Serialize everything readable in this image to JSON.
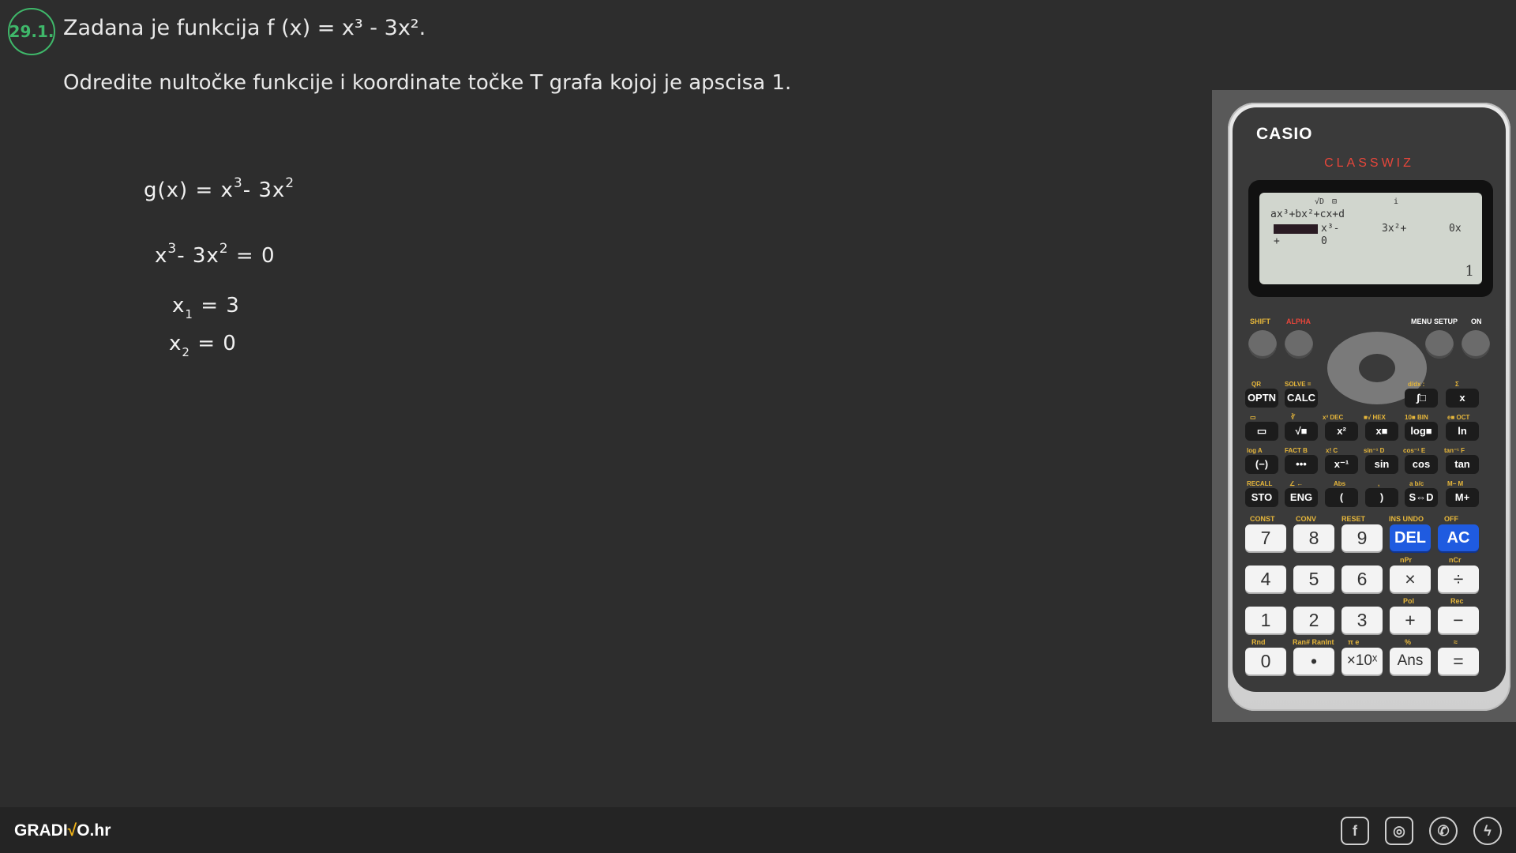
{
  "problem": {
    "number": "29.1.",
    "line1": "Zadana je funkcija f (x) = x³ - 3x².",
    "line2": "Odredite nultočke funkcije i koordinate točke T grafa kojoj je apscisa 1."
  },
  "work": {
    "line1_lhs": "g(x) = x",
    "line1_exp1": "3",
    "line1_mid": "- 3x",
    "line1_exp2": "2",
    "line2_a": "x",
    "line2_exp1": "3",
    "line2_b": "- 3x",
    "line2_exp2": "2",
    "line2_c": "= 0",
    "root1_var": "x",
    "root1_sub": "1",
    "root1_val": "= 3",
    "root2_var": "x",
    "root2_sub": "2",
    "root2_val": "= 0"
  },
  "calculator": {
    "brand": "CASIO",
    "model": "CLASSWIZ",
    "lcd": {
      "indicators": [
        "√D",
        "⊟",
        "i"
      ],
      "form": "ax³+bx²+cx+d",
      "term1": "x³-",
      "term2": "3x²+",
      "term3": "0x",
      "row3_a": "+",
      "row3_b": "0",
      "result": "1"
    },
    "top_labels": {
      "shift": "SHIFT",
      "alpha": "ALPHA",
      "menu_setup": "MENU SETUP",
      "on": "ON"
    },
    "func_rows": [
      [
        {
          "label": "OPTN",
          "note": "QR"
        },
        {
          "label": "CALC",
          "note": "SOLVE ="
        },
        {
          "label": "∫□",
          "note": "d/dx  :"
        },
        {
          "label": "x",
          "note": "Σ"
        }
      ],
      [
        {
          "label": "▭",
          "note": "▭"
        },
        {
          "label": "√■",
          "note": "∛"
        },
        {
          "label": "x²",
          "note": "x³ DEC"
        },
        {
          "label": "x■",
          "note": "■√ HEX"
        },
        {
          "label": "log■",
          "note": "10■ BIN"
        },
        {
          "label": "ln",
          "note": "e■ OCT"
        }
      ],
      [
        {
          "label": "(−)",
          "note": "log A"
        },
        {
          "label": "•••",
          "note": "FACT B"
        },
        {
          "label": "x⁻¹",
          "note": "x! C"
        },
        {
          "label": "sin",
          "note": "sin⁻¹ D"
        },
        {
          "label": "cos",
          "note": "cos⁻¹ E"
        },
        {
          "label": "tan",
          "note": "tan⁻¹ F"
        }
      ],
      [
        {
          "label": "STO",
          "note": "RECALL"
        },
        {
          "label": "ENG",
          "note": "∠ ←"
        },
        {
          "label": "(",
          "note": "Abs"
        },
        {
          "label": ")",
          "note": ","
        },
        {
          "label": "S⇔D",
          "note": "a b/c"
        },
        {
          "label": "M+",
          "note": "M−  M"
        }
      ]
    ],
    "num_rows": [
      [
        {
          "label": "7",
          "note": "CONST"
        },
        {
          "label": "8",
          "note": "CONV"
        },
        {
          "label": "9",
          "note": "RESET"
        },
        {
          "label": "DEL",
          "note": "INS UNDO",
          "blue": true
        },
        {
          "label": "AC",
          "note": "OFF",
          "blue": true
        }
      ],
      [
        {
          "label": "4",
          "note": ""
        },
        {
          "label": "5",
          "note": ""
        },
        {
          "label": "6",
          "note": ""
        },
        {
          "label": "×",
          "note": "nPr"
        },
        {
          "label": "÷",
          "note": "nCr"
        }
      ],
      [
        {
          "label": "1",
          "note": ""
        },
        {
          "label": "2",
          "note": ""
        },
        {
          "label": "3",
          "note": ""
        },
        {
          "label": "+",
          "note": "Pol"
        },
        {
          "label": "−",
          "note": "Rec"
        }
      ],
      [
        {
          "label": "0",
          "note": "Rnd"
        },
        {
          "label": "•",
          "note": "Ran# RanInt"
        },
        {
          "label": "×10ˣ",
          "note": "π  e"
        },
        {
          "label": "Ans",
          "note": "%"
        },
        {
          "label": "=",
          "note": "≈"
        }
      ]
    ]
  },
  "footer": {
    "logo_left": "GRADI",
    "logo_accent": "√",
    "logo_right": "O.hr",
    "social": [
      {
        "icon": "facebook-icon",
        "glyph": "f"
      },
      {
        "icon": "instagram-icon",
        "glyph": "◎"
      },
      {
        "icon": "whatsapp-icon",
        "glyph": "✆"
      },
      {
        "icon": "messenger-icon",
        "glyph": "ϟ"
      }
    ]
  },
  "colors": {
    "background": "#2d2d2d",
    "badge": "#3fb86a",
    "calc_red": "#e7463a",
    "calc_blue": "#1f5be0",
    "logo_accent": "#f2b418"
  }
}
